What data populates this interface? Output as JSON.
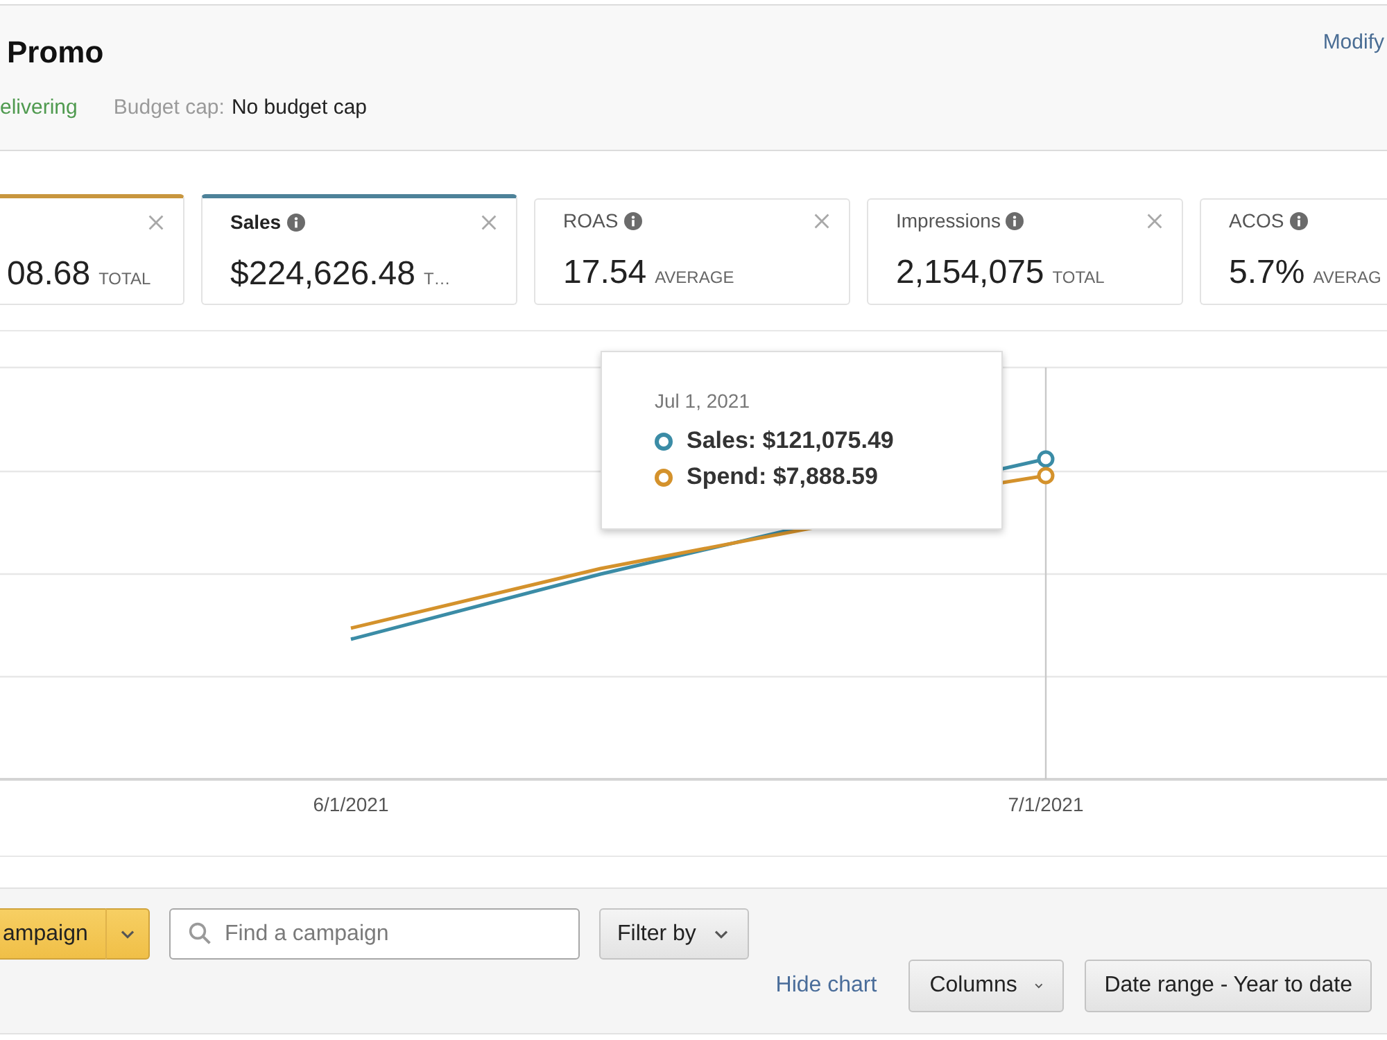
{
  "header": {
    "title": "Promo",
    "status": "elivering",
    "budget_label": "Budget cap:",
    "budget_value": "No budget cap",
    "modify_link": "Modify"
  },
  "metrics": [
    {
      "value": "08.68",
      "aggregate": "TOTAL",
      "selected": true,
      "color": "#c8963e",
      "close_button": true
    },
    {
      "title": "Sales",
      "value": "$224,626.48",
      "aggregate": "T…",
      "selected": true,
      "color": "#4d8299",
      "close_button": true
    },
    {
      "title": "ROAS",
      "value": "17.54",
      "aggregate": "AVERAGE",
      "selected": false,
      "close_button": true
    },
    {
      "title": "Impressions",
      "value": "2,154,075",
      "aggregate": "TOTAL",
      "selected": false,
      "close_button": true
    },
    {
      "title": "ACOS",
      "value": "5.7%",
      "aggregate": "AVERAG",
      "selected": false,
      "close_button": false
    }
  ],
  "chart": {
    "x_labels": [
      "6/1/2021",
      "7/1/2021"
    ],
    "tooltip": {
      "date": "Jul 1, 2021",
      "entries": [
        {
          "text": "Sales: $121,075.49",
          "color": "#3b8ca6"
        },
        {
          "text": "Spend: $7,888.59",
          "color": "#d4922c"
        }
      ]
    }
  },
  "toolbar": {
    "create_button": "ampaign",
    "search": {
      "placeholder": "Find a campaign"
    },
    "filter_button": "Filter by",
    "hide_chart_link": "Hide chart",
    "columns_button": "Columns",
    "date_range_button": "Date range - Year to date"
  }
}
